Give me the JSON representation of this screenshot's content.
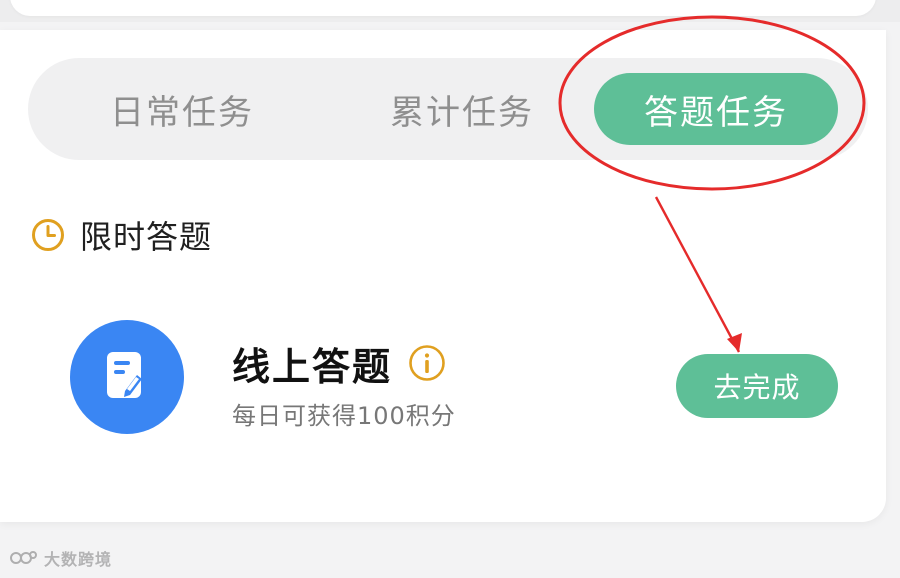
{
  "tabs": [
    {
      "label": "日常任务",
      "active": false
    },
    {
      "label": "累计任务",
      "active": false
    },
    {
      "label": "答题任务",
      "active": true
    }
  ],
  "section": {
    "icon": "clock-icon",
    "title": "限时答题"
  },
  "task": {
    "icon": "edit-note-icon",
    "title": "线上答题",
    "info_icon": "info-icon",
    "description": "每日可获得100积分",
    "button_label": "去完成"
  },
  "watermark": {
    "text": "大数跨境"
  },
  "colors": {
    "accent_green": "#5ebf97",
    "task_icon_blue": "#3a86f3",
    "annotation_red": "#e52b2b",
    "clock_orange": "#e0a020"
  }
}
